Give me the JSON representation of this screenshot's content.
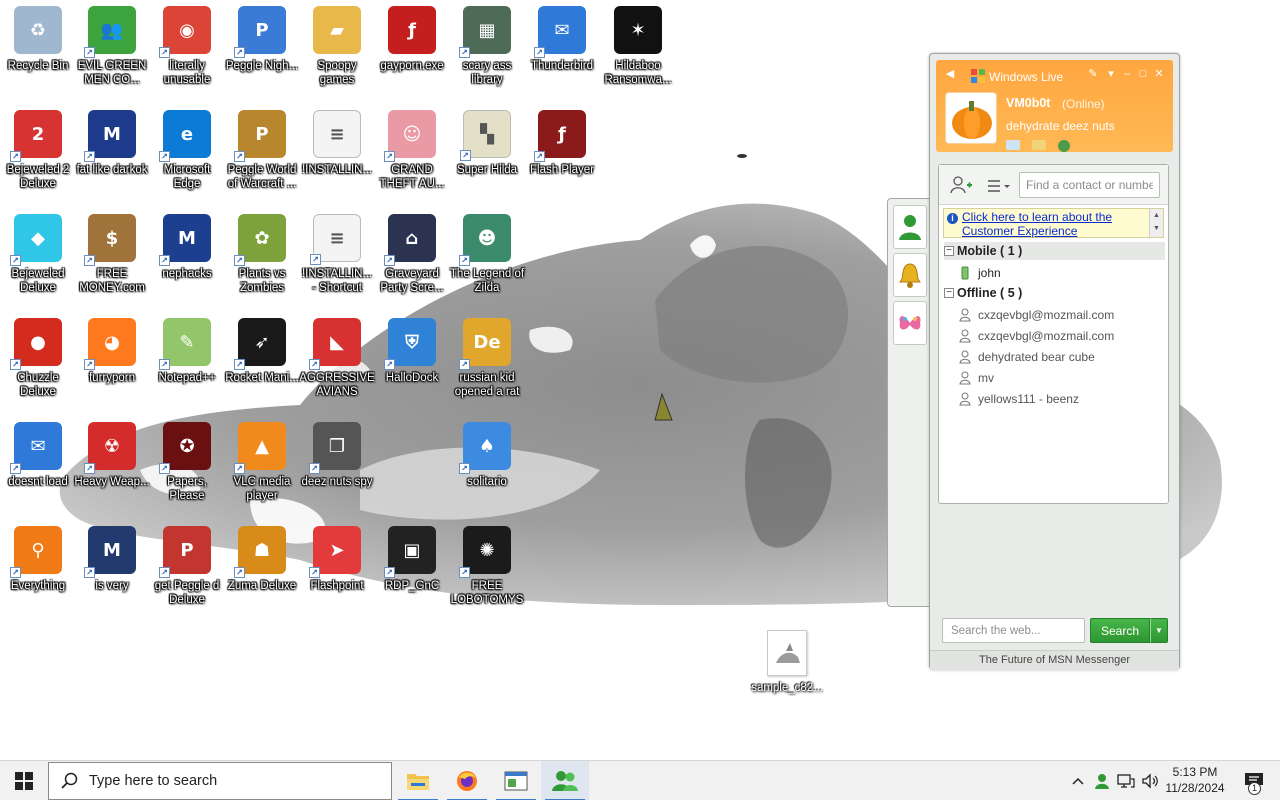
{
  "desktop": {
    "icons": [
      {
        "label": "Recycle Bin",
        "icon": "recycle-bin-icon",
        "color": "#9fb7cf",
        "glyph": "♻",
        "shortcut": false
      },
      {
        "label": "EVIL GREEN MEN CO...",
        "icon": "msn-people-icon",
        "color": "#3da33d",
        "glyph": "👥",
        "shortcut": true
      },
      {
        "label": "literally unusable",
        "icon": "chrome-icon",
        "color": "#db4437",
        "glyph": "◉",
        "shortcut": true
      },
      {
        "label": "Peggle Nigh...",
        "icon": "peggle-icon",
        "color": "#3a7bd5",
        "glyph": "P",
        "shortcut": true
      },
      {
        "label": "Spoopy games",
        "icon": "folder-icon",
        "color": "#e8b84a",
        "glyph": "▰",
        "shortcut": false
      },
      {
        "label": "gayporn.exe",
        "icon": "flash-icon",
        "color": "#c41e1e",
        "glyph": "ƒ",
        "shortcut": false
      },
      {
        "label": "scary ass library",
        "icon": "library-icon",
        "color": "#4d6b57",
        "glyph": "▦",
        "shortcut": true
      },
      {
        "label": "Thunderbird",
        "icon": "thunderbird-icon",
        "color": "#2f7ad8",
        "glyph": "✉",
        "shortcut": true
      },
      {
        "label": "Hildaboo Ransomwa...",
        "icon": "yashma-icon",
        "color": "#111111",
        "glyph": "✶",
        "shortcut": false
      },
      {
        "label": "Bejeweled 2 Deluxe",
        "icon": "bejeweled-2-icon",
        "color": "#d83333",
        "glyph": "2",
        "shortcut": true
      },
      {
        "label": "fat like darkok",
        "icon": "mpi-icon",
        "color": "#1e3a8a",
        "glyph": "M",
        "shortcut": true
      },
      {
        "label": "Microsoft Edge",
        "icon": "edge-icon",
        "color": "#0c7bd6",
        "glyph": "e",
        "shortcut": true
      },
      {
        "label": "Peggle World of Warcraft ...",
        "icon": "peggle-wow-icon",
        "color": "#b8862c",
        "glyph": "P",
        "shortcut": true
      },
      {
        "label": "!INSTALLIN...",
        "icon": "text-file-icon",
        "color": "#f4f4f4",
        "glyph": "≡",
        "shortcut": false
      },
      {
        "label": "GRAND THEFT AU...",
        "icon": "gta-girl-icon",
        "color": "#e99aa5",
        "glyph": "☺",
        "shortcut": true
      },
      {
        "label": "Super Hilda",
        "icon": "super-hilda-icon",
        "color": "#e4e0c7",
        "glyph": "▚",
        "shortcut": true
      },
      {
        "label": "Flash Player",
        "icon": "flash-player-icon",
        "color": "#8b1a1a",
        "glyph": "ƒ",
        "shortcut": true
      },
      {
        "label": "Bejeweled Deluxe",
        "icon": "diamond-icon",
        "color": "#2fc6e8",
        "glyph": "◆",
        "shortcut": true
      },
      {
        "label": "FREE MONEY.com",
        "icon": "money-bag-icon",
        "color": "#a0733a",
        "glyph": "$",
        "shortcut": true
      },
      {
        "label": "nephacks",
        "icon": "mpi-blue-icon",
        "color": "#1d3f8f",
        "glyph": "M",
        "shortcut": true
      },
      {
        "label": "Plants vs Zombies",
        "icon": "pvz-icon",
        "color": "#7da23b",
        "glyph": "✿",
        "shortcut": true
      },
      {
        "label": "!INSTALLIN... - Shortcut",
        "icon": "text-file-shortcut-icon",
        "color": "#f4f4f4",
        "glyph": "≡",
        "shortcut": true
      },
      {
        "label": "Graveyard Party Scre...",
        "icon": "graveyard-icon",
        "color": "#2c3350",
        "glyph": "⌂",
        "shortcut": true
      },
      {
        "label": "The Legend of Zilda",
        "icon": "zilda-icon",
        "color": "#3b8a6b",
        "glyph": "☻",
        "shortcut": true
      },
      {
        "label": "Chuzzle Deluxe",
        "icon": "chuzzle-icon",
        "color": "#d42b1f",
        "glyph": "●",
        "shortcut": true
      },
      {
        "label": "furryporn",
        "icon": "firefox-icon",
        "color": "#ff7a1f",
        "glyph": "◕",
        "shortcut": true
      },
      {
        "label": "Notepad++",
        "icon": "notepadpp-icon",
        "color": "#93c56a",
        "glyph": "✎",
        "shortcut": true
      },
      {
        "label": "Rocket Mani...",
        "icon": "rocket-icon",
        "color": "#1a1a1a",
        "glyph": "➶",
        "shortcut": true
      },
      {
        "label": "AGGRESSIVE AVIANS",
        "icon": "angry-bird-icon",
        "color": "#d83131",
        "glyph": "◣",
        "shortcut": true
      },
      {
        "label": "HalloDock",
        "icon": "windows-shield-icon",
        "color": "#2f82d6",
        "glyph": "⛨",
        "shortcut": true
      },
      {
        "label": "russian kid opened a rat",
        "icon": "de-icon",
        "color": "#e0a72c",
        "glyph": "De",
        "shortcut": true
      },
      {
        "label": "doesnt load",
        "icon": "thunderbird-2-icon",
        "color": "#2f7ad8",
        "glyph": "✉",
        "shortcut": true
      },
      {
        "label": "Heavy Weap...",
        "icon": "radiation-icon",
        "color": "#d42b2b",
        "glyph": "☢",
        "shortcut": true
      },
      {
        "label": "Papers, Please",
        "icon": "papers-please-icon",
        "color": "#6a1010",
        "glyph": "✪",
        "shortcut": true
      },
      {
        "label": "VLC media player",
        "icon": "vlc-icon",
        "color": "#f08a1c",
        "glyph": "▲",
        "shortcut": true
      },
      {
        "label": "deez nuts spy",
        "icon": "windows-stack-icon",
        "color": "#555555",
        "glyph": "❐",
        "shortcut": true
      },
      {
        "label": "solitario",
        "icon": "solitario-icon",
        "color": "#3d8be0",
        "glyph": "♠",
        "shortcut": true
      },
      {
        "label": "Everything",
        "icon": "magnifier-icon",
        "color": "#f07a16",
        "glyph": "⚲",
        "shortcut": true
      },
      {
        "label": "is very",
        "icon": "mpi-dark-icon",
        "color": "#223a6e",
        "glyph": "M",
        "shortcut": true
      },
      {
        "label": "get Peggle d Deluxe",
        "icon": "peggle-deluxe-icon",
        "color": "#c2362f",
        "glyph": "P",
        "shortcut": true
      },
      {
        "label": "Zuma Deluxe",
        "icon": "zuma-icon",
        "color": "#d98b1a",
        "glyph": "☗",
        "shortcut": true
      },
      {
        "label": "Flashpoint",
        "icon": "flashpoint-icon",
        "color": "#e33b3b",
        "glyph": "➤",
        "shortcut": true
      },
      {
        "label": "RDP_GnC",
        "icon": "rdp-icon",
        "color": "#222222",
        "glyph": "▣",
        "shortcut": true
      },
      {
        "label": "FREE LOBOTOMYS",
        "icon": "lobotomy-icon",
        "color": "#1b1b1b",
        "glyph": "✺",
        "shortcut": true
      }
    ],
    "loose_file": {
      "label": "sample_c82...",
      "icon": "image-file-icon"
    }
  },
  "msn": {
    "title": "Windows Live",
    "user_name": "VM0b0t",
    "status": "(Online)",
    "personal_message": "dehydrate deez nuts",
    "contact_search_placeholder": "Find a contact or number",
    "info_link": "Click here to learn about the Customer Experience",
    "groups": [
      {
        "name": "Mobile ( 1 )",
        "contacts": [
          "john"
        ]
      },
      {
        "name": "Offline ( 5 )",
        "contacts": [
          "cxzqevbgl@mozmail.com",
          "cxzqevbgl@mozmail.com",
          "dehydrated bear cube",
          "mv",
          "yellows111 - beenz"
        ]
      }
    ],
    "web_search_placeholder": "Search the web...",
    "search_button": "Search",
    "footer": "The Future of MSN Messenger",
    "colors": {
      "header": "#ffab45",
      "search_button": "#2d9731",
      "link": "#0a2bd0"
    }
  },
  "taskbar": {
    "search_placeholder": "Type here to search",
    "apps": [
      {
        "name": "file-explorer",
        "icon": "folder-icon"
      },
      {
        "name": "firefox",
        "icon": "firefox-icon"
      },
      {
        "name": "app-window",
        "icon": "window-icon"
      },
      {
        "name": "msn-messenger",
        "icon": "msn-people-icon"
      }
    ],
    "time": "5:13 PM",
    "date": "11/28/2024",
    "notifications": "1"
  }
}
